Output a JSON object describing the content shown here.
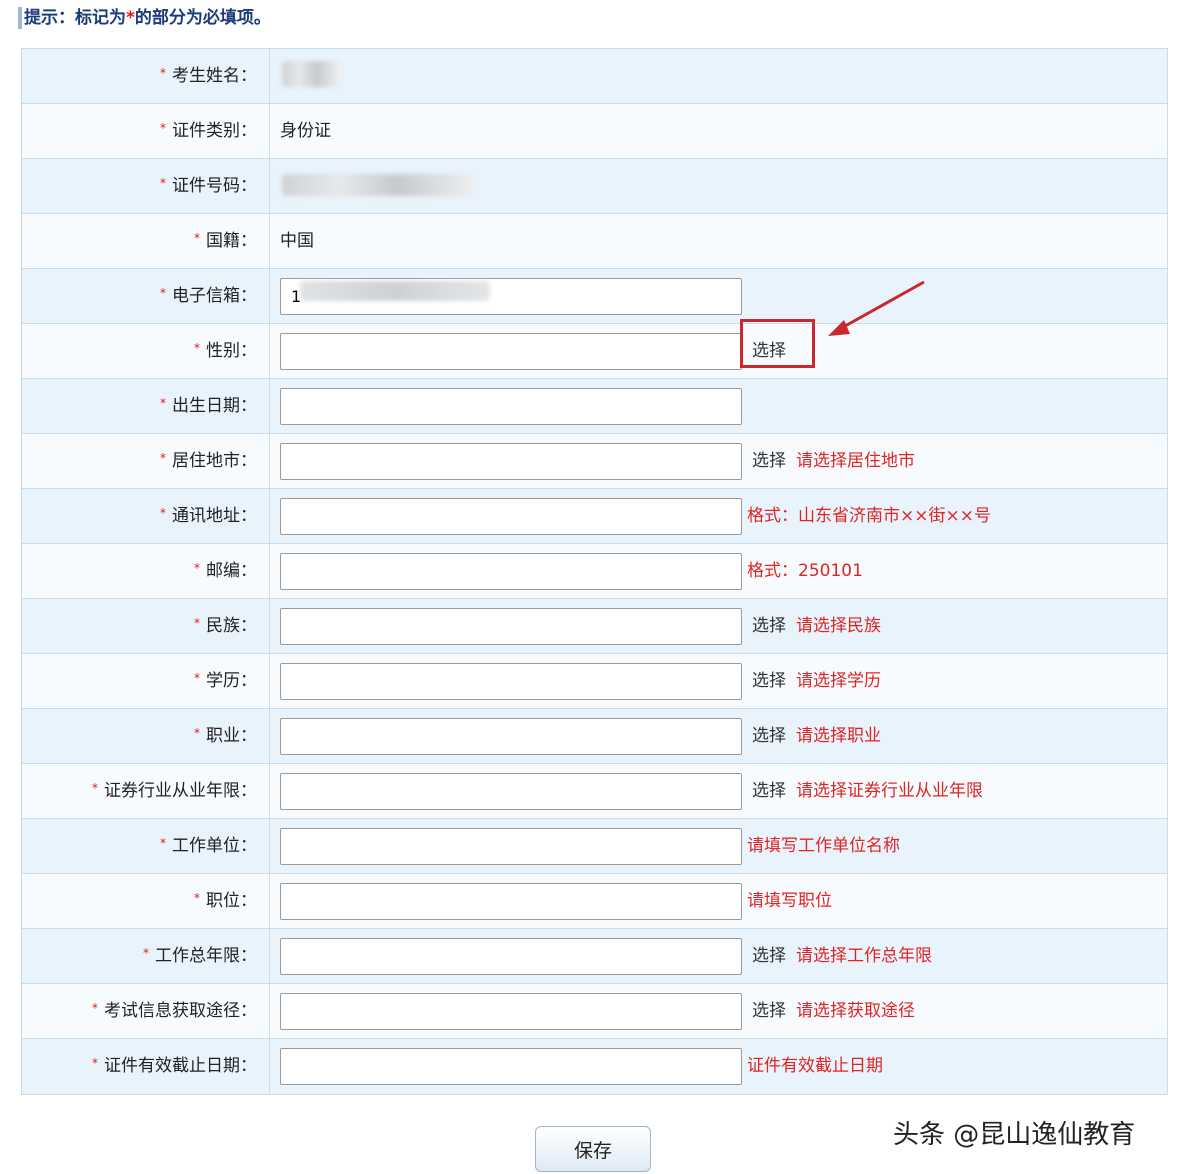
{
  "tip": {
    "prefix": "提示：标记为",
    "star": "*",
    "suffix": "的部分为必填项。"
  },
  "form": {
    "required_mark": "*",
    "rows": [
      {
        "label": "考生姓名："
      },
      {
        "label": "证件类别：",
        "value": "身份证"
      },
      {
        "label": "证件号码："
      },
      {
        "label": "国籍：",
        "value": "中国"
      },
      {
        "label": "电子信箱：",
        "input_value": "1"
      },
      {
        "label": "性别：",
        "select": "选择"
      },
      {
        "label": "出生日期："
      },
      {
        "label": "居住地市：",
        "select": "选择",
        "hint": "请选择居住地市"
      },
      {
        "label": "通讯地址：",
        "hint": "格式：山东省济南市××街××号"
      },
      {
        "label": "邮编：",
        "hint": "格式：250101"
      },
      {
        "label": "民族：",
        "select": "选择",
        "hint": "请选择民族"
      },
      {
        "label": "学历：",
        "select": "选择",
        "hint": "请选择学历"
      },
      {
        "label": "职业：",
        "select": "选择",
        "hint": "请选择职业"
      },
      {
        "label": "证券行业从业年限：",
        "select": "选择",
        "hint": "请选择证券行业从业年限"
      },
      {
        "label": "工作单位：",
        "hint": "请填写工作单位名称"
      },
      {
        "label": "职位：",
        "hint": "请填写职位"
      },
      {
        "label": "工作总年限：",
        "select": "选择",
        "hint": "请选择工作总年限"
      },
      {
        "label": "考试信息获取途径：",
        "select": "选择",
        "hint": "请选择获取途径"
      },
      {
        "label": "证件有效截止日期：",
        "hint": "证件有效截止日期"
      }
    ]
  },
  "save_label": "保存",
  "watermark": "头条 @昆山逸仙教育",
  "colors": {
    "required": "#d91e1e",
    "hint": "#e02424",
    "highlight_box": "#c8282e",
    "row_odd": "#e9f3fb",
    "border": "#c9dcec"
  }
}
